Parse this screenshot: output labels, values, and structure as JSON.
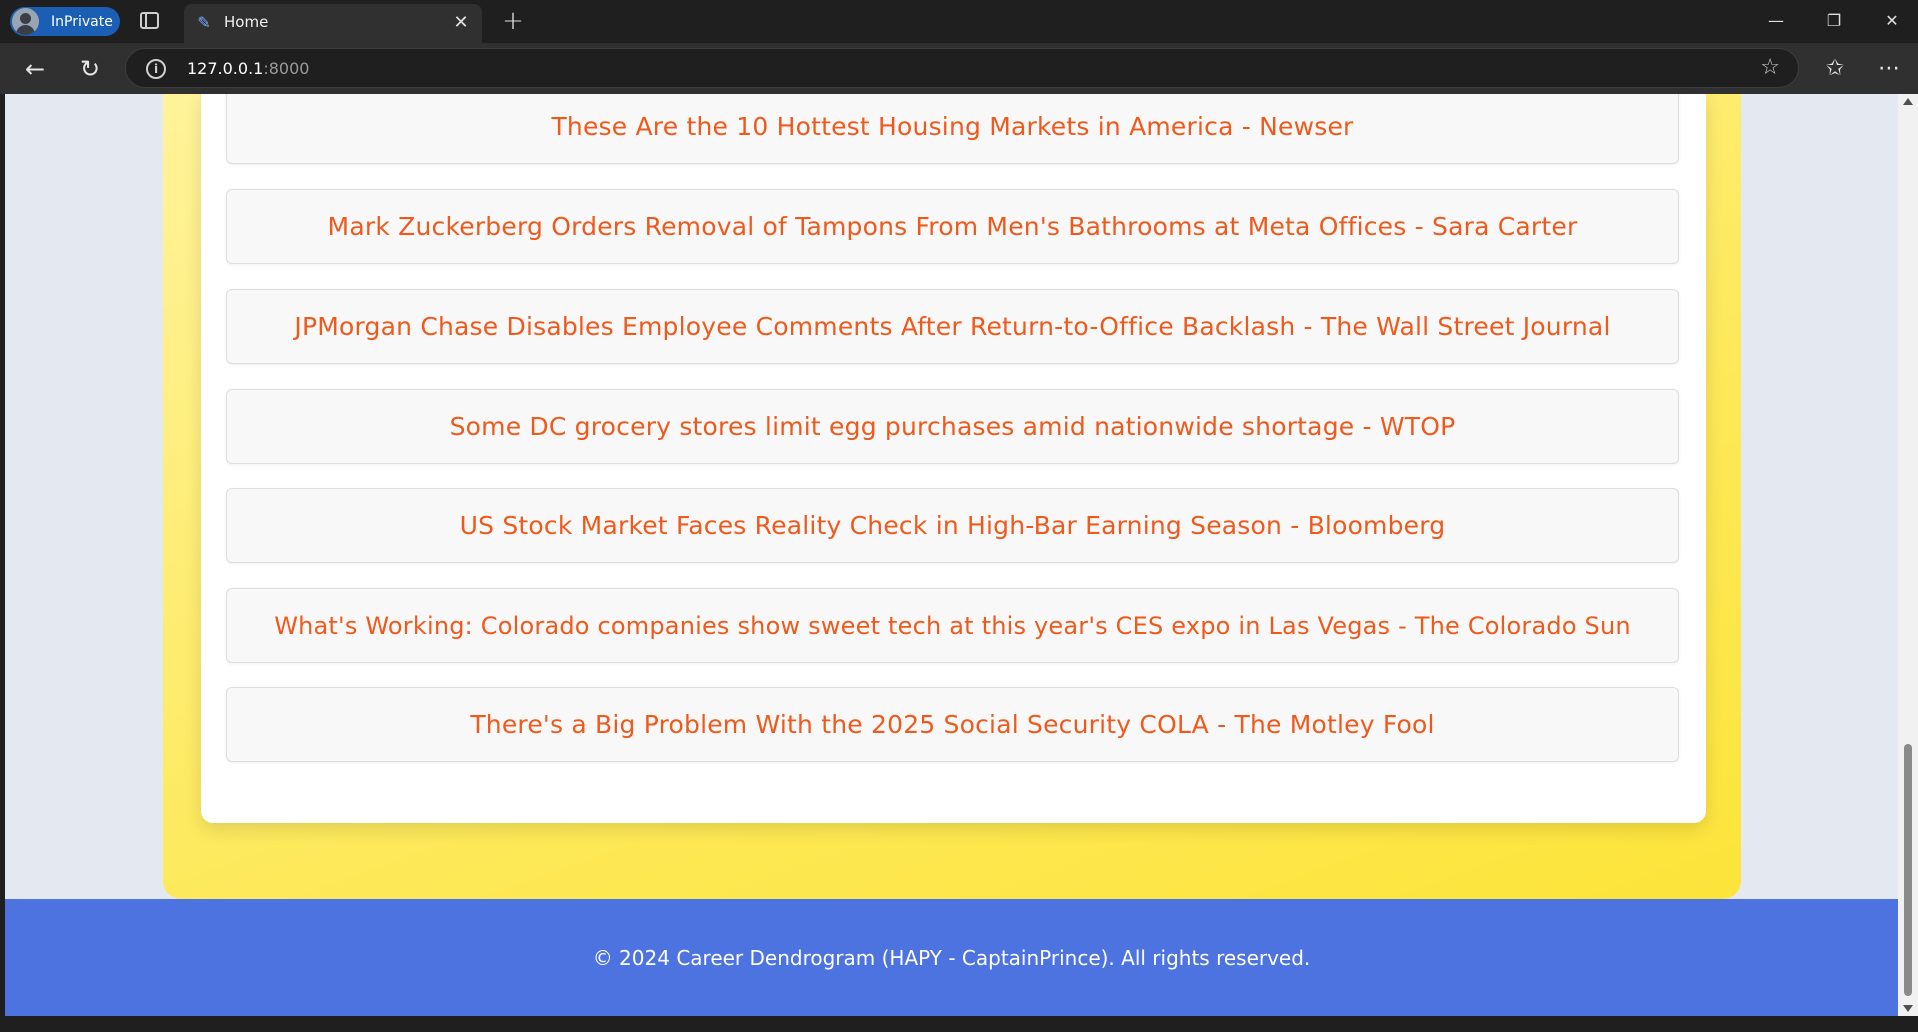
{
  "browser": {
    "profile_label": "InPrivate",
    "tab_title": "Home",
    "url_host": "127.0.0.1",
    "url_port": ":8000"
  },
  "news": [
    {
      "headline": "These Are the 10 Hottest Housing Markets in America - Newser"
    },
    {
      "headline": "Mark Zuckerberg Orders Removal of Tampons From Men's Bathrooms at Meta Offices - Sara Carter"
    },
    {
      "headline": "JPMorgan Chase Disables Employee Comments After Return-to-Office Backlash - The Wall Street Journal"
    },
    {
      "headline": "Some DC grocery stores limit egg purchases amid nationwide shortage - WTOP"
    },
    {
      "headline": "US Stock Market Faces Reality Check in High-Bar Earning Season - Bloomberg"
    },
    {
      "headline": "What's Working: Colorado companies show sweet tech at this year's CES expo in Las Vegas - The Colorado Sun"
    },
    {
      "headline": "There's a Big Problem With the 2025 Social Security COLA - The Motley Fool"
    }
  ],
  "footer": {
    "copyright": "© 2024 Career Dendrogram (HAPY - CaptainPrince). All rights reserved."
  },
  "colors": {
    "headline": "#ef5a1c",
    "footer_bg": "#4c73e0",
    "panel": "#fde95a"
  }
}
